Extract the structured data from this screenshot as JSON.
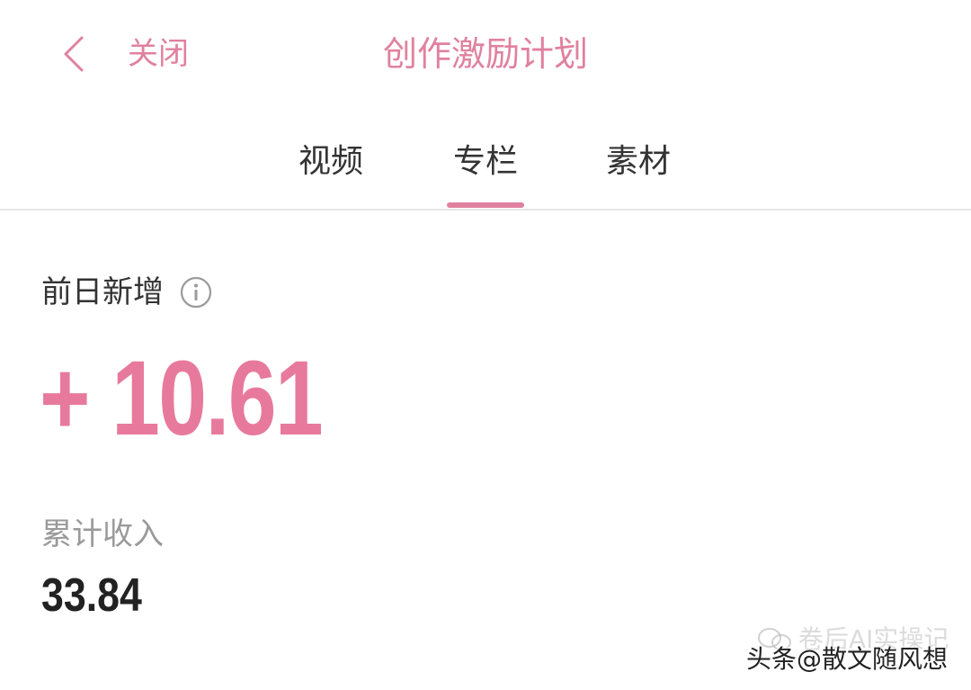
{
  "header": {
    "back_icon": "chevron-left-icon",
    "close_label": "关闭",
    "title": "创作激励计划"
  },
  "tabs": [
    {
      "label": "视频",
      "active": false
    },
    {
      "label": "专栏",
      "active": true
    },
    {
      "label": "素材",
      "active": false
    }
  ],
  "metric": {
    "label": "前日新增",
    "info_icon": "info-icon",
    "value": "+ 10.61"
  },
  "total": {
    "label": "累计收入",
    "value": "33.84"
  },
  "watermarks": {
    "faint_text": "卷后AI实操记",
    "main_text": "头条@散文随风想"
  },
  "colors": {
    "accent": "#e0819f",
    "metric_value": "#e77a9c",
    "text_primary": "#333333",
    "text_secondary": "#9a9a9a"
  }
}
